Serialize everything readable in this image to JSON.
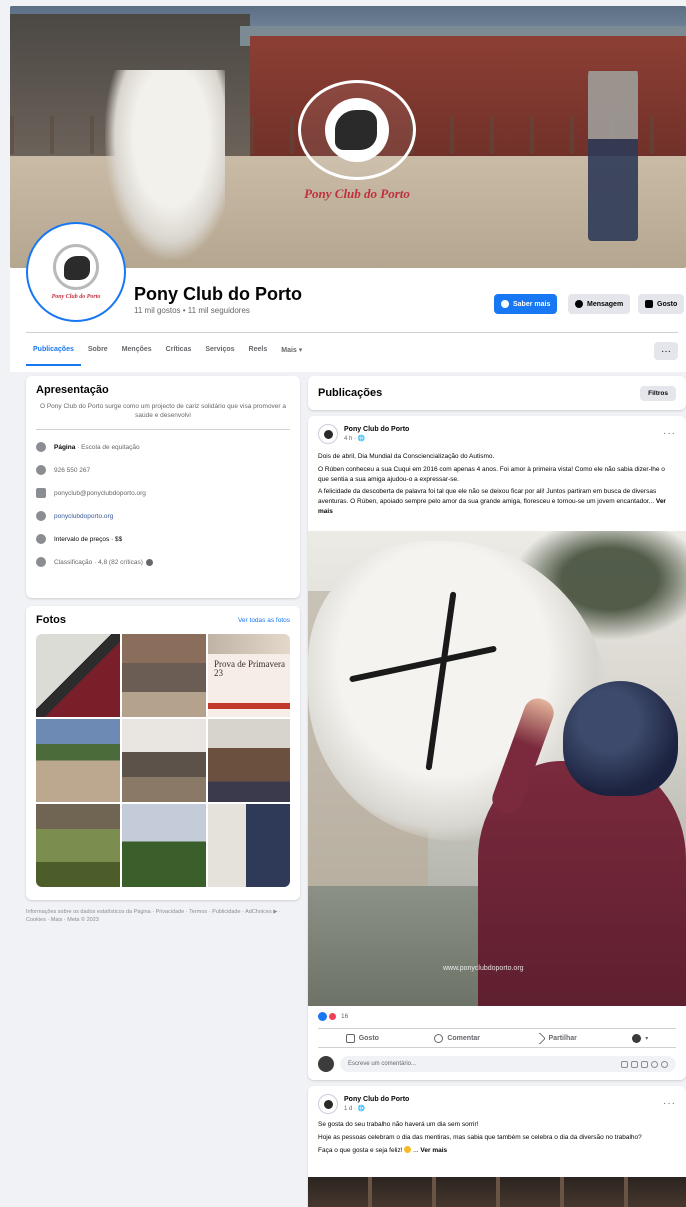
{
  "cover": {
    "logo_text": "Pony Club do Porto"
  },
  "avatar": {
    "text": "Pony Club do Porto"
  },
  "page": {
    "name": "Pony Club do Porto",
    "stats": "11 mil gostos • 11 mil seguidores"
  },
  "buttons": {
    "learn_more": "Saber mais",
    "message": "Mensagem",
    "like": "Gosto"
  },
  "tabs": [
    "Publicações",
    "Sobre",
    "Menções",
    "Críticas",
    "Serviços",
    "Reels",
    "Mais ▾"
  ],
  "more_menu": "···",
  "intro": {
    "title": "Apresentação",
    "description": "O Pony Club do Porto surge como um projecto de cariz solidário que visa promover a saúde e desenvolvi",
    "rows": [
      {
        "prefix": "Página",
        "text": " · Escola de equitação"
      },
      {
        "text": "926 550 267"
      },
      {
        "text": "ponyclub@ponyclubdoporto.org"
      },
      {
        "text": "ponyclubdoporto.org"
      },
      {
        "prefix": "",
        "text": "Intervalo de preços · $$"
      },
      {
        "text": "Classificação · 4,8 (82 críticas)"
      }
    ]
  },
  "photos": {
    "title": "Fotos",
    "see_all": "Ver todas as fotos",
    "poster_title": "Prova de Primavera 23"
  },
  "footer": "Informações sobre os dados estatísticos da Página · Privacidade · Termos · Publicidade · AdChoices ▶ · Cookies · Mais · Meta © 2023",
  "publications": {
    "title": "Publicações",
    "filters": "Filtros"
  },
  "post1": {
    "author": "Pony Club do Porto",
    "time": "4 h · 🌐",
    "paragraphs": [
      "Dois de abril, Dia Mundial da Consciencialização do Autismo.",
      "O Rúben conheceu a sua Cuqui em 2016 com apenas 4 anos. Foi amor à primeira vista! Como ele não sabia dizer-lhe o que sentia a sua amiga ajudou-o a expressar-se.",
      "A felicidade da descoberta de palavra foi tal que ele não se deixou ficar por ali! Juntos partiram em busca de diversas aventuras. O Rúben, apoiado sempre pelo amor da sua grande amiga, floresceu e tornou-se um jovem encantador..."
    ],
    "see_more": "Ver mais",
    "watermark": "www.ponyclubdoporto.org",
    "reactions_count": "16",
    "actions": {
      "like": "Gosto",
      "comment": "Comentar",
      "share": "Partilhar"
    },
    "comment_placeholder": "Escreve um comentário..."
  },
  "post2": {
    "author": "Pony Club do Porto",
    "time": "1 d · 🌐",
    "paragraphs": [
      "Se gosta do seu trabalho não haverá um dia sem sorrir!",
      "Hoje as pessoas celebram o dia das mentiras, mas sabia que também se celebra o dia da diversão no trabalho?",
      "Faça o que gosta e seja feliz!"
    ],
    "see_more": "Ver mais"
  }
}
